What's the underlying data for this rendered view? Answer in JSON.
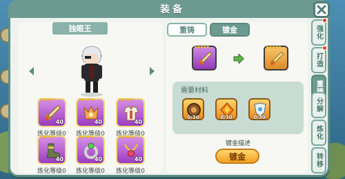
{
  "window": {
    "title": "装备"
  },
  "hero": {
    "name": "独眼王"
  },
  "equipment": [
    {
      "level": "40",
      "label": "炼化等级0",
      "stars": "★★★★★",
      "icon": "sword-icon"
    },
    {
      "level": "40",
      "label": "炼化等级0",
      "stars": "★★★★★",
      "icon": "hood-icon"
    },
    {
      "level": "40",
      "label": "炼化等级0",
      "stars": "★★★★★",
      "icon": "armor-icon"
    },
    {
      "level": "40",
      "label": "炼化等级0",
      "stars": "★★★★★",
      "icon": "boots-icon"
    },
    {
      "level": "40",
      "label": "炼化等级0",
      "stars": "★★★★★",
      "icon": "ring-icon"
    },
    {
      "level": "40",
      "label": "炼化等级0",
      "stars": "★★★★★",
      "icon": "necklace-icon"
    }
  ],
  "sub_tabs": [
    {
      "label": "重铸",
      "active": false
    },
    {
      "label": "镀金",
      "active": true
    }
  ],
  "upgrade": {
    "from_stars": "★★★★★",
    "to_stars": "★★★★★"
  },
  "materials": {
    "title": "需要材料",
    "items": [
      {
        "count": "0/30",
        "icon": "gear-material-icon"
      },
      {
        "count": "0/30",
        "icon": "orange-gem-icon"
      },
      {
        "count": "0/30",
        "icon": "crest-icon"
      }
    ]
  },
  "description": "镀金描述",
  "gild_button": "镀金",
  "side_tabs": [
    {
      "label": "强化",
      "active": false,
      "badge": true
    },
    {
      "label": "打造",
      "active": false,
      "badge": true
    },
    {
      "label": "重铸",
      "active": true,
      "badge": false
    },
    {
      "label": "分解",
      "active": false,
      "badge": false
    },
    {
      "label": "炼化",
      "active": false,
      "badge": false
    },
    {
      "label": "转移",
      "active": false,
      "badge": false
    }
  ],
  "colors": {
    "frame": "#6c9a91",
    "purple_rarity": "#b058d6",
    "gold_button": "#f0a020"
  }
}
